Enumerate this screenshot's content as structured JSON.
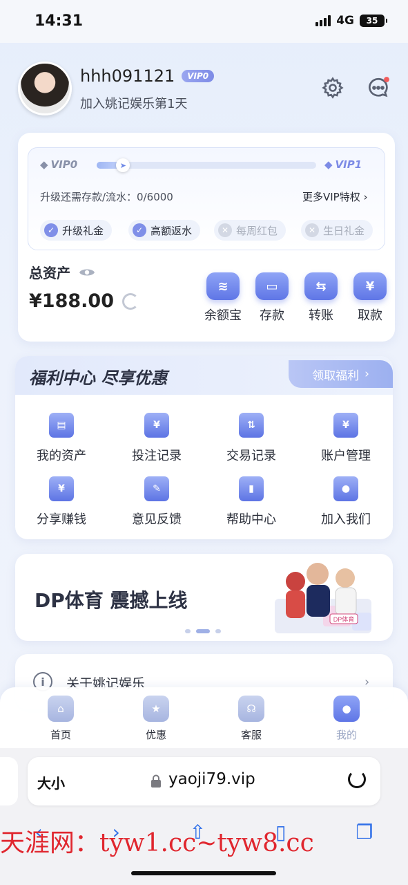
{
  "status": {
    "time": "14:31",
    "network": "4G",
    "battery": "35"
  },
  "profile": {
    "username": "hhh091121",
    "vip_badge": "VIP0",
    "subtitle": "加入姚记娱乐第1天"
  },
  "vip": {
    "current": "VIP0",
    "next": "VIP1",
    "progress": 0.07,
    "upgrade_text": "升级还需存款/流水：0/6000",
    "more_link": "更多VIP特权",
    "perks": [
      {
        "label": "升级礼金",
        "enabled": true
      },
      {
        "label": "高额返水",
        "enabled": true
      },
      {
        "label": "每周红包",
        "enabled": false
      },
      {
        "label": "生日礼金",
        "enabled": false
      }
    ]
  },
  "assets": {
    "label": "总资产",
    "value": "¥188.00",
    "actions": [
      {
        "label": "余额宝",
        "icon": "coin-stack-icon"
      },
      {
        "label": "存款",
        "icon": "wallet-icon"
      },
      {
        "label": "转账",
        "icon": "transfer-icon"
      },
      {
        "label": "取款",
        "icon": "withdraw-icon"
      }
    ]
  },
  "welfare": {
    "title": "福利中心  尽享优惠",
    "button": "领取福利",
    "items": [
      {
        "label": "我的资产",
        "icon": "wallet-icon"
      },
      {
        "label": "投注记录",
        "icon": "bet-record-icon"
      },
      {
        "label": "交易记录",
        "icon": "transaction-icon"
      },
      {
        "label": "账户管理",
        "icon": "account-icon"
      },
      {
        "label": "分享赚钱",
        "icon": "share-money-icon"
      },
      {
        "label": "意见反馈",
        "icon": "feedback-icon"
      },
      {
        "label": "帮助中心",
        "icon": "help-book-icon"
      },
      {
        "label": "加入我们",
        "icon": "team-icon"
      }
    ]
  },
  "banner": {
    "title": "DP体育 震撼上线",
    "art_label": "DP体育",
    "slide_index": 1,
    "slide_count": 3
  },
  "about": {
    "label": "关于姚记娱乐"
  },
  "tabbar": {
    "tabs": [
      {
        "label": "首页",
        "icon": "home-icon",
        "active": false
      },
      {
        "label": "优惠",
        "icon": "gift-icon",
        "active": false
      },
      {
        "label": "客服",
        "icon": "headset-icon",
        "active": false
      },
      {
        "label": "我的",
        "icon": "user-icon",
        "active": true
      }
    ]
  },
  "browser": {
    "text_size": "大小",
    "url": "yaoji79.vip"
  },
  "watermark": "天涯网：tyw1.cc~tyw8.cc",
  "colors": {
    "accent": "#6b82ea",
    "watermark": "#e0262e"
  }
}
